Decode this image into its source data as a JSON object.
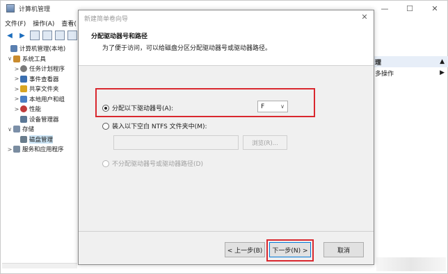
{
  "window": {
    "title": "计算机管理",
    "min_glyph": "—",
    "max_glyph": "☐",
    "close_glyph": "✕"
  },
  "menu": [
    "文件(F)",
    "操作(A)",
    "查看("
  ],
  "tree": [
    {
      "label": "计算机管理(本地)",
      "caret": "",
      "icon": "computer-management-icon",
      "color": "#5a7fb0"
    },
    {
      "label": "系统工具",
      "caret": "∨",
      "icon": "system-tools-icon",
      "color": "#c98b2e"
    },
    {
      "label": "任务计划程序",
      "caret": ">",
      "icon": "task-scheduler-icon",
      "color": "#7a7a7a"
    },
    {
      "label": "事件查看器",
      "caret": ">",
      "icon": "event-viewer-icon",
      "color": "#3b6fb0"
    },
    {
      "label": "共享文件夹",
      "caret": ">",
      "icon": "shared-folders-icon",
      "color": "#d9a521"
    },
    {
      "label": "本地用户和组",
      "caret": ">",
      "icon": "local-users-icon",
      "color": "#4b7fc4"
    },
    {
      "label": "性能",
      "caret": ">",
      "icon": "performance-icon",
      "color": "#c03a3a"
    },
    {
      "label": "设备管理器",
      "caret": "",
      "icon": "device-manager-icon",
      "color": "#5c7895"
    },
    {
      "label": "存储",
      "caret": "∨",
      "icon": "storage-icon",
      "color": "#7b8fa8"
    },
    {
      "label": "磁盘管理",
      "caret": "",
      "icon": "disk-management-icon",
      "color": "#6a7d8c"
    },
    {
      "label": "服务和应用程序",
      "caret": ">",
      "icon": "services-apps-icon",
      "color": "#7a8ca0"
    }
  ],
  "actions": {
    "header": "理",
    "header_arrow": "▲",
    "more": "多操作",
    "more_arrow": "▶"
  },
  "wizard": {
    "title": "新建简单卷向导",
    "close_glyph": "✕",
    "heading": "分配驱动器号和路径",
    "subheading": "为了便于访问，可以给磁盘分区分配驱动器号或驱动器路径。",
    "option_assign": "分配以下驱动器号(A):",
    "drive_letter": "F",
    "option_mount": "装入以下空白 NTFS 文件夹中(M):",
    "browse_label": "浏览(R)...",
    "option_none": "不分配驱动器号或驱动器路径(D)",
    "back_label": "< 上一步(B)",
    "next_label": "下一步(N) >",
    "cancel_label": "取消"
  },
  "colors": {
    "highlight": "#d9272e",
    "accent": "#0078d7",
    "selected_row": "#cde6f7"
  }
}
